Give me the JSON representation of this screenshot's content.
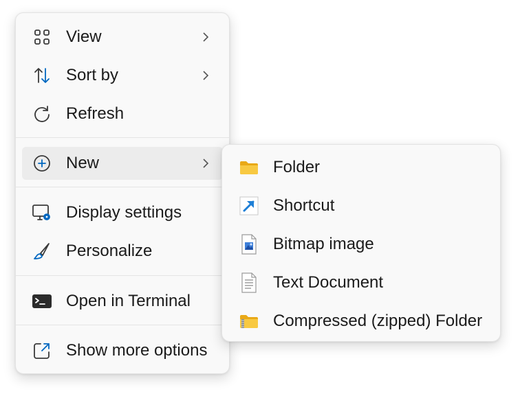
{
  "main_menu": {
    "items": [
      {
        "label": "View",
        "icon": "grid-icon",
        "has_submenu": true
      },
      {
        "label": "Sort by",
        "icon": "sort-arrows-icon",
        "has_submenu": true
      },
      {
        "label": "Refresh",
        "icon": "refresh-icon",
        "has_submenu": false
      },
      {
        "label": "New",
        "icon": "plus-circle-icon",
        "has_submenu": true,
        "highlighted": true
      },
      {
        "label": "Display settings",
        "icon": "display-settings-icon",
        "has_submenu": false
      },
      {
        "label": "Personalize",
        "icon": "paintbrush-icon",
        "has_submenu": false
      },
      {
        "label": "Open in Terminal",
        "icon": "terminal-icon",
        "has_submenu": false
      },
      {
        "label": "Show more options",
        "icon": "open-external-icon",
        "has_submenu": false
      }
    ]
  },
  "new_submenu": {
    "items": [
      {
        "label": "Folder",
        "icon": "folder-icon"
      },
      {
        "label": "Shortcut",
        "icon": "shortcut-arrow-icon"
      },
      {
        "label": "Bitmap image",
        "icon": "bitmap-file-icon"
      },
      {
        "label": "Text Document",
        "icon": "text-document-icon"
      },
      {
        "label": "Compressed (zipped) Folder",
        "icon": "zipped-folder-icon"
      }
    ]
  },
  "colors": {
    "menu_background": "#f9f9f9",
    "hover_background": "#ececec",
    "accent": "#0067c0",
    "folder_yellow": "#f8c942"
  }
}
